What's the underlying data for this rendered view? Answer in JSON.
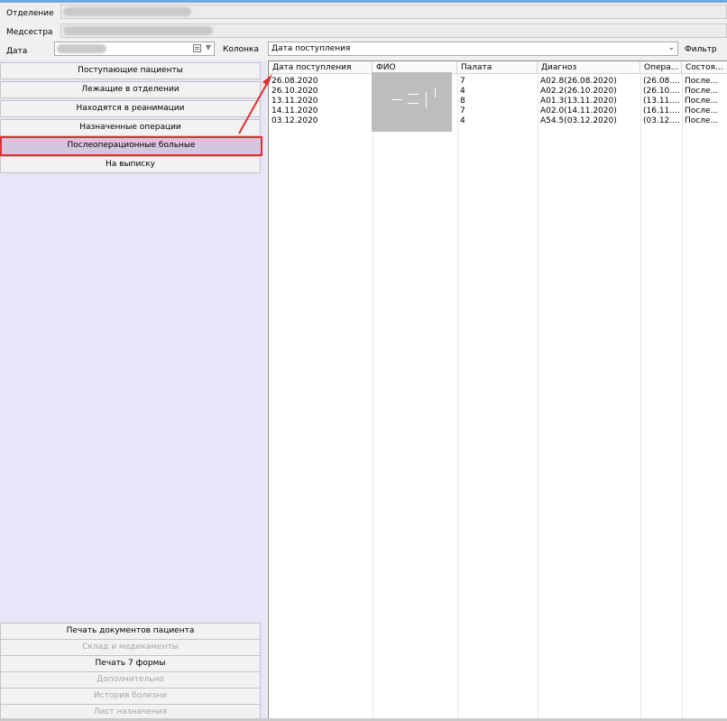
{
  "form": {
    "department_label": "Отделение",
    "nurse_label": "Медсестра",
    "date_label": "Дата",
    "column_label": "Колонка",
    "column_value": "Дата поступления",
    "filter_label": "Фильтр"
  },
  "nav": [
    {
      "label": "Поступающие пациенты"
    },
    {
      "label": "Лежащие в отделении"
    },
    {
      "label": "Находятся в реанимации"
    },
    {
      "label": "Назначенные операции"
    },
    {
      "label": "Послеоперационные больные"
    },
    {
      "label": "На выписку"
    }
  ],
  "bottom_nav": [
    {
      "label": "Печать документов пациента"
    },
    {
      "label": "Склад и медикаменты"
    },
    {
      "label": "Печать 7 формы"
    },
    {
      "label": "Дополнительно"
    },
    {
      "label": "История болезни"
    },
    {
      "label": "Лист назначения"
    }
  ],
  "table": {
    "columns": [
      "Дата поступления",
      "ФИО",
      "Палата",
      "Диагноз",
      "Опера...",
      "Состоя..."
    ],
    "rows": [
      [
        "26.08.2020",
        "",
        "7",
        "A02.8(26.08.2020)",
        "(26.08....",
        "После..."
      ],
      [
        "26.10.2020",
        "",
        "4",
        "A02.2(26.10.2020)",
        "(26.10....",
        "После..."
      ],
      [
        "13.11.2020",
        "",
        "8",
        "A01.3(13.11.2020)",
        "(13.11....",
        "После..."
      ],
      [
        "14.11.2020",
        "",
        "7",
        "A02.0(14.11.2020)",
        "(16.11....",
        "После..."
      ],
      [
        "03.12.2020",
        "",
        "4",
        "A54.5(03.12.2020)",
        "(03.12....",
        "После..."
      ]
    ]
  },
  "colors": {
    "selected_bg": "#d6c5de",
    "highlight": "#e03030",
    "panel_bg": "#e6e6f8"
  }
}
